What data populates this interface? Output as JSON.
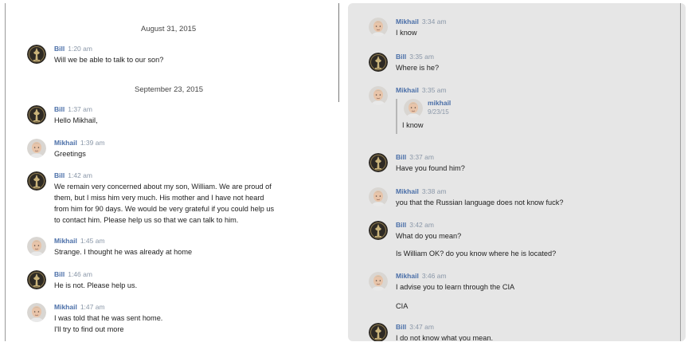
{
  "left": {
    "date_1": "August 31, 2015",
    "date_2": "September 23, 2015",
    "messages": [
      {
        "name": "Bill",
        "time": "1:20 am",
        "lines": [
          "Will we be able to talk to our son?"
        ]
      },
      {
        "name": "Bill",
        "time": "1:37 am",
        "lines": [
          "Hello Mikhail,"
        ]
      },
      {
        "name": "Mikhail",
        "time": "1:39 am",
        "lines": [
          "Greetings"
        ]
      },
      {
        "name": "Bill",
        "time": "1:42 am",
        "lines": [
          "We remain very concerned about my son, William. We are proud of",
          "them, but I miss him very much. His mother and I have not heard",
          "from him for 90 days. We would be very grateful if you could help us",
          "to contact him. Please help us so that we can talk to him."
        ]
      },
      {
        "name": "Mikhail",
        "time": "1:45 am",
        "lines": [
          "Strange. I thought he was already at home"
        ]
      },
      {
        "name": "Bill",
        "time": "1:46 am",
        "lines": [
          "He is not. Please help us."
        ]
      },
      {
        "name": "Mikhail",
        "time": "1:47 am",
        "lines": [
          "I was told that he was sent home.",
          "I'll try to find out more"
        ]
      }
    ]
  },
  "right": {
    "messages": [
      {
        "name": "Mikhail",
        "time": "3:34 am",
        "lines": [
          "I know"
        ]
      },
      {
        "name": "Bill",
        "time": "3:35 am",
        "lines": [
          "Where is he?"
        ]
      },
      {
        "name": "Mikhail",
        "time": "3:35 am",
        "lines": [],
        "quote": {
          "name": "mikhail",
          "date": "9/23/15",
          "text": "I know"
        }
      },
      {
        "name": "Bill",
        "time": "3:37 am",
        "lines": [
          "Have you found him?"
        ]
      },
      {
        "name": "Mikhail",
        "time": "3:38 am",
        "lines": [
          "you that the Russian language does not know fuck?"
        ]
      },
      {
        "name": "Bill",
        "time": "3:42 am",
        "lines": [
          "What do you mean?",
          "Is William OK? do you know where he is located?"
        ]
      },
      {
        "name": "Mikhail",
        "time": "3:46 am",
        "lines": [
          "I advise you to learn through the CIA",
          "CIA"
        ]
      },
      {
        "name": "Bill",
        "time": "3:47 am",
        "lines": [
          "I do not know what you mean."
        ]
      }
    ]
  },
  "icons": {
    "bill": "bill-avatar-icon",
    "mikhail": "mikhail-avatar-icon"
  },
  "colors": {
    "name": "#4b6fa8",
    "time": "#8a97a8",
    "right_bg": "#e6e6e6"
  }
}
